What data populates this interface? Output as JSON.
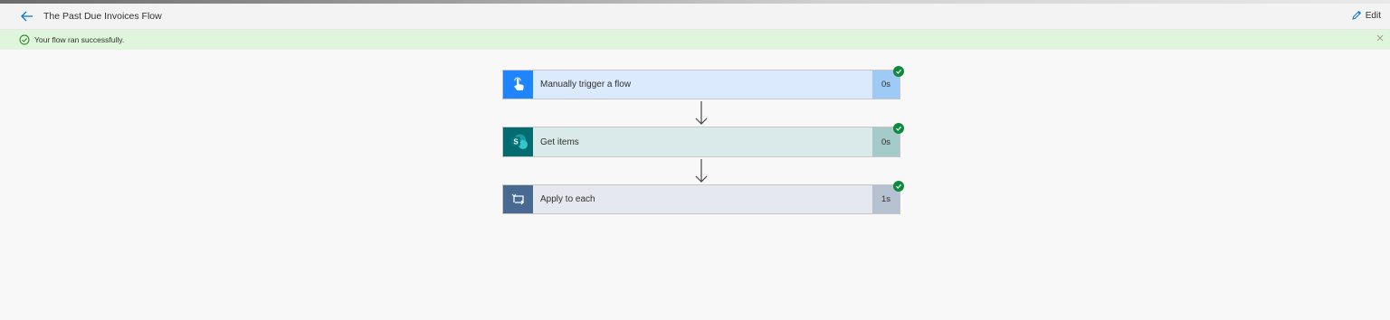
{
  "header": {
    "title": "The Past Due Invoices Flow",
    "edit_label": "Edit"
  },
  "banner": {
    "message": "Your flow ran successfully."
  },
  "steps": [
    {
      "label": "Manually trigger a flow",
      "duration": "0s",
      "icon": "touch-icon",
      "status": "success"
    },
    {
      "label": "Get items",
      "duration": "0s",
      "icon": "sharepoint-icon",
      "status": "success"
    },
    {
      "label": "Apply to each",
      "duration": "1s",
      "icon": "loop-icon",
      "status": "success"
    }
  ],
  "colors": {
    "trigger_icon_bg": "#1f85ff",
    "trigger_body": "#dbeafc",
    "trigger_dur": "#9ecbf5",
    "sharepoint_icon_bg": "#036c70",
    "sharepoint_body": "#daeaea",
    "sharepoint_dur": "#a4cbc9",
    "loop_icon_bg": "#486991",
    "loop_body": "#e5e9ef",
    "loop_dur": "#b6c2d1",
    "success_green": "#0e8a3c",
    "banner_bg": "#dff6dd"
  }
}
